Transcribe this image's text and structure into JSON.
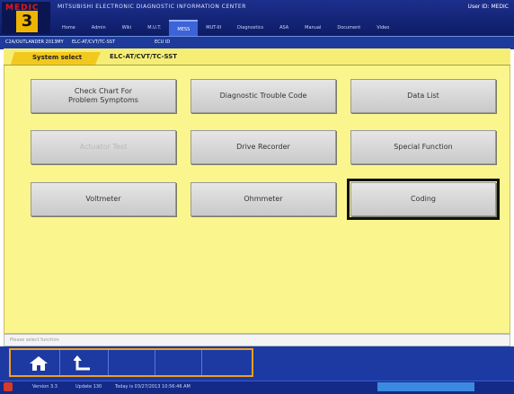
{
  "app": {
    "logo_text": "MEDIC",
    "logo_number": "3",
    "title": "MITSUBISHI ELECTRONIC DIAGNOSTIC INFORMATION CENTER",
    "user": "User ID: MEDIC"
  },
  "menubar": {
    "items": [
      "Home",
      "Admin",
      "Wiki",
      "M.U.T.",
      "MESS",
      "MUT-III",
      "Diagnostics",
      "ASA",
      "Manual",
      "Document",
      "Video"
    ],
    "active_index": 4
  },
  "breadcrumb": {
    "vehicle": "C2A/OUTLANDER 2013MY",
    "system": "ELC-AT/CVT/TC-SST",
    "ecu_id": "ECU ID"
  },
  "tabs": {
    "system_select": "System select",
    "current": "ELC-AT/CVT/TC-SST"
  },
  "functions": [
    {
      "label": "Check Chart For\nProblem Symptoms",
      "disabled": false,
      "highlighted": false
    },
    {
      "label": "Diagnostic Trouble Code",
      "disabled": false,
      "highlighted": false
    },
    {
      "label": "Data List",
      "disabled": false,
      "highlighted": false
    },
    {
      "label": "Actuator Test",
      "disabled": true,
      "highlighted": false
    },
    {
      "label": "Drive Recorder",
      "disabled": false,
      "highlighted": false
    },
    {
      "label": "Special Function",
      "disabled": false,
      "highlighted": false
    },
    {
      "label": "Voltmeter",
      "disabled": false,
      "highlighted": false
    },
    {
      "label": "Ohmmeter",
      "disabled": false,
      "highlighted": false
    },
    {
      "label": "Coding",
      "disabled": false,
      "highlighted": true
    }
  ],
  "status": {
    "message": "Please select function"
  },
  "toolbar": {
    "home_icon": "home-icon",
    "back_icon": "back-arrow-icon"
  },
  "taskbar": {
    "version": "Version 3.3",
    "update": "Update 130",
    "date": "Today is 03/27/2013 10:56:46 AM"
  },
  "colors": {
    "panel": "#fbf58e",
    "titlebar": "#1c2f8c",
    "tab_active": "#f3c81e",
    "toolbar_frame": "#f0a020"
  }
}
